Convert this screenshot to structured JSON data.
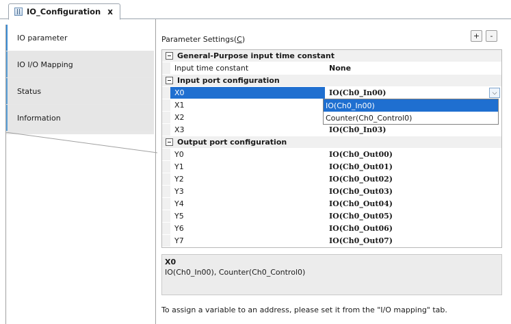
{
  "document_tab": {
    "title": "IO_Configuration",
    "close": "x"
  },
  "left_tabs": [
    {
      "label": "IO parameter",
      "active": true
    },
    {
      "label": "IO I/O Mapping",
      "active": false
    },
    {
      "label": "Status",
      "active": false
    },
    {
      "label": "Information",
      "active": false
    }
  ],
  "panel": {
    "title_prefix": "Parameter Settings(",
    "title_key": "C",
    "title_suffix": ")",
    "expand_button": "+",
    "collapse_button": "-"
  },
  "groups": [
    {
      "name": "General-Purpose input time constant",
      "rows": [
        {
          "name": "Input time constant",
          "value": "None"
        }
      ]
    },
    {
      "name": "Input port configuration",
      "rows": [
        {
          "name": "X0",
          "value": "IO(Ch0_In00)",
          "selected": true
        },
        {
          "name": "X1",
          "value": ""
        },
        {
          "name": "X2",
          "value": ""
        },
        {
          "name": "X3",
          "value": "IO(Ch0_In03)"
        }
      ]
    },
    {
      "name": "Output port configuration",
      "rows": [
        {
          "name": "Y0",
          "value": "IO(Ch0_Out00)"
        },
        {
          "name": "Y1",
          "value": "IO(Ch0_Out01)"
        },
        {
          "name": "Y2",
          "value": "IO(Ch0_Out02)"
        },
        {
          "name": "Y3",
          "value": "IO(Ch0_Out03)"
        },
        {
          "name": "Y4",
          "value": "IO(Ch0_Out04)"
        },
        {
          "name": "Y5",
          "value": "IO(Ch0_Out05)"
        },
        {
          "name": "Y6",
          "value": "IO(Ch0_Out06)"
        },
        {
          "name": "Y7",
          "value": "IO(Ch0_Out07)"
        }
      ]
    }
  ],
  "dropdown": {
    "options": [
      {
        "label": "IO(Ch0_In00)",
        "selected": true
      },
      {
        "label": "Counter(Ch0_Control0)",
        "selected": false
      }
    ]
  },
  "description": {
    "title": "X0",
    "text": "IO(Ch0_In00), Counter(Ch0_Control0)"
  },
  "footer_note": "To assign a variable to an address, please set it from the \"I/O mapping\" tab.",
  "colors": {
    "selection": "#1f6fd0",
    "tab_accent": "#3a8dd6"
  }
}
